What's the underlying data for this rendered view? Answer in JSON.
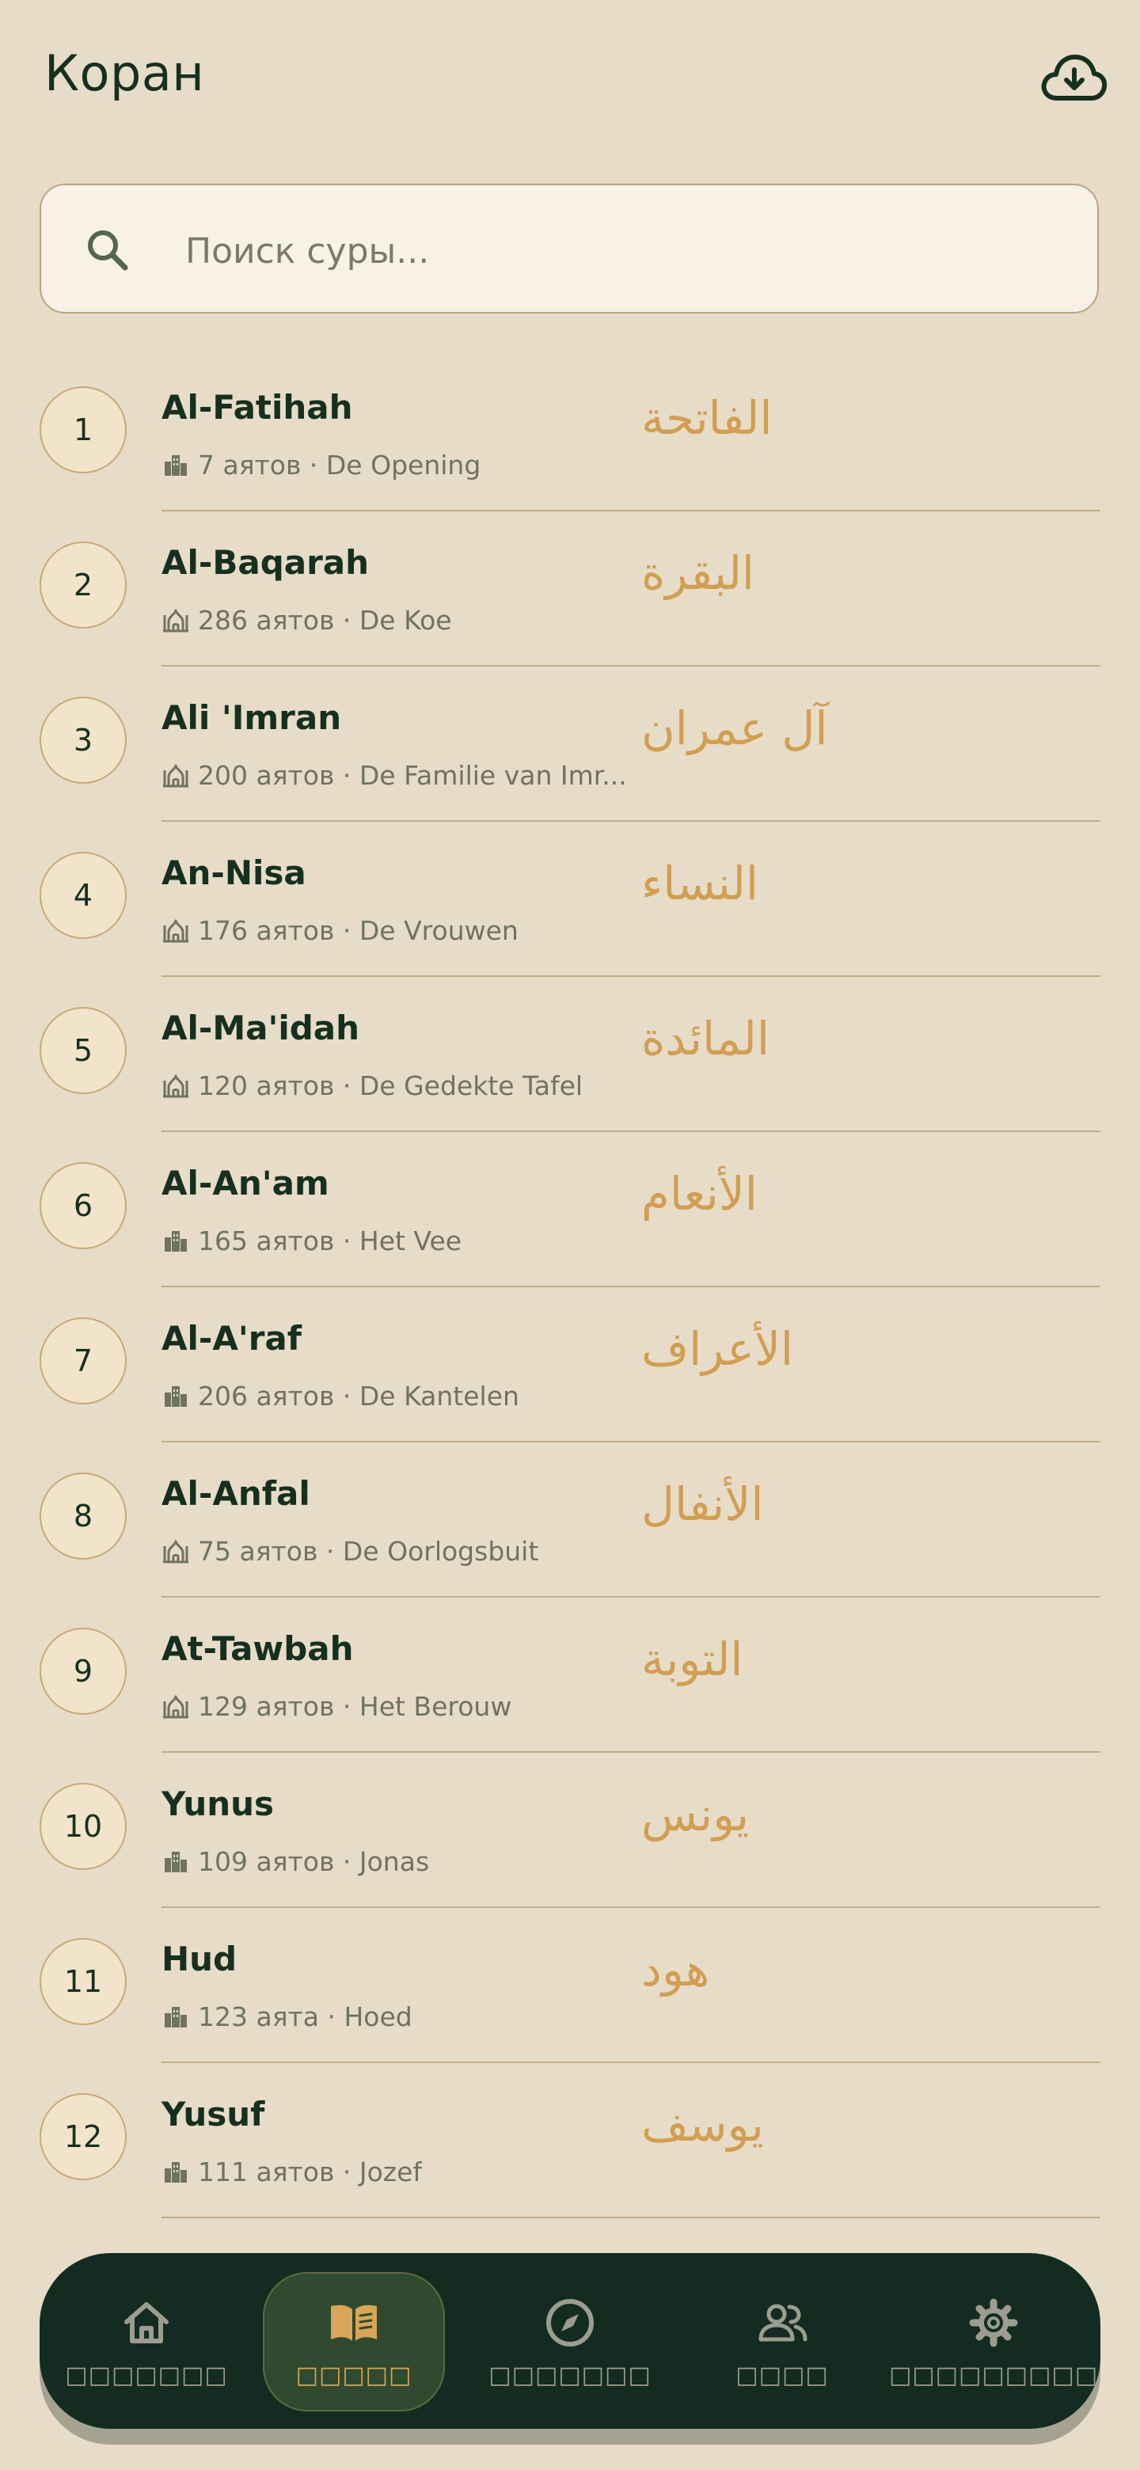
{
  "header": {
    "title": "Коран",
    "download_icon": "cloud-download-icon"
  },
  "search": {
    "placeholder": "Поиск суры..."
  },
  "surahs": [
    {
      "number": "1",
      "name": "Al-Fatihah",
      "meta": "7 аятов · De Opening",
      "arabic": "الفاتحة",
      "place": "medina"
    },
    {
      "number": "2",
      "name": "Al-Baqarah",
      "meta": "286 аятов · De Koe",
      "arabic": "البقرة",
      "place": "mosque"
    },
    {
      "number": "3",
      "name": "Ali 'Imran",
      "meta": "200 аятов · De Familie van Imr...",
      "arabic": "آل عمران",
      "place": "mosque"
    },
    {
      "number": "4",
      "name": "An-Nisa",
      "meta": "176 аятов · De Vrouwen",
      "arabic": "النساء",
      "place": "mosque"
    },
    {
      "number": "5",
      "name": "Al-Ma'idah",
      "meta": "120 аятов · De Gedekte Tafel",
      "arabic": "المائدة",
      "place": "mosque"
    },
    {
      "number": "6",
      "name": "Al-An'am",
      "meta": "165 аятов · Het Vee",
      "arabic": "الأنعام",
      "place": "medina"
    },
    {
      "number": "7",
      "name": "Al-A'raf",
      "meta": "206 аятов · De Kantelen",
      "arabic": "الأعراف",
      "place": "medina"
    },
    {
      "number": "8",
      "name": "Al-Anfal",
      "meta": "75 аятов · De Oorlogsbuit",
      "arabic": "الأنفال",
      "place": "mosque"
    },
    {
      "number": "9",
      "name": "At-Tawbah",
      "meta": "129 аятов · Het Berouw",
      "arabic": "التوبة",
      "place": "mosque"
    },
    {
      "number": "10",
      "name": "Yunus",
      "meta": "109 аятов · Jonas",
      "arabic": "يونس",
      "place": "medina"
    },
    {
      "number": "11",
      "name": "Hud",
      "meta": "123 аята · Hoed",
      "arabic": "هود",
      "place": "medina"
    },
    {
      "number": "12",
      "name": "Yusuf",
      "meta": "111 аятов · Jozef",
      "arabic": "يوسف",
      "place": "medina"
    }
  ],
  "nav": [
    {
      "label": "□□□□□□□",
      "icon": "home-icon",
      "active": false
    },
    {
      "label": "□□□□□",
      "icon": "book-icon",
      "active": true
    },
    {
      "label": "□□□□□□□",
      "icon": "compass-icon",
      "active": false
    },
    {
      "label": "□□□□",
      "icon": "people-icon",
      "active": false
    },
    {
      "label": "□□□□□□□□□",
      "icon": "settings-icon",
      "active": false
    }
  ],
  "colors": {
    "background": "#e7dcc8",
    "accent": "#d19e52",
    "dark": "#132b20"
  }
}
